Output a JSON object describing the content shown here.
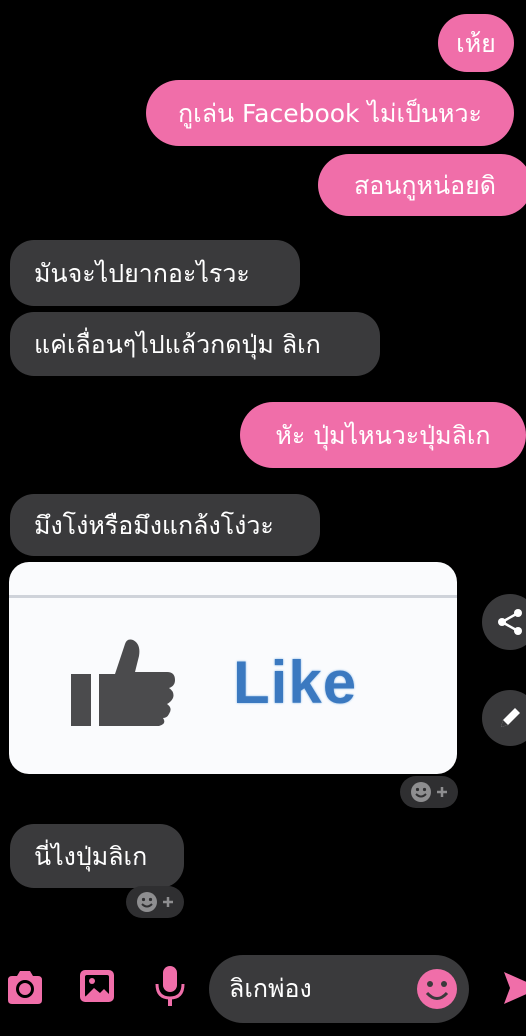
{
  "messages": {
    "m1": "เห้ย",
    "m2": "กูเล่น Facebook ไม่เป็นหวะ",
    "m3": "สอนกูหน่อยดิ",
    "m4": "มันจะไปยากอะไรวะ",
    "m5": "แค่เลื่อนๆไปแล้วกดปุ่ม ลิเก",
    "m6": "หัะ ปุ่มไหนวะปุ่มลิเก",
    "m7": "มึงโง่หรือมึงแกล้งโง่วะ",
    "m9": "นี่ไงปุ่มลิเก"
  },
  "image": {
    "like_word": "Like"
  },
  "composer": {
    "value": "ลิเกพ่อง"
  },
  "colors": {
    "accent": "#f06ea9",
    "received_bubble": "#3a3a3c",
    "background": "#000000",
    "like_blue": "#3b79c0"
  },
  "icons": [
    "camera-icon",
    "image-icon",
    "microphone-icon",
    "emoji-icon",
    "send-icon",
    "share-icon",
    "edit-icon",
    "add-reaction-icon",
    "thumbs-up-icon"
  ]
}
